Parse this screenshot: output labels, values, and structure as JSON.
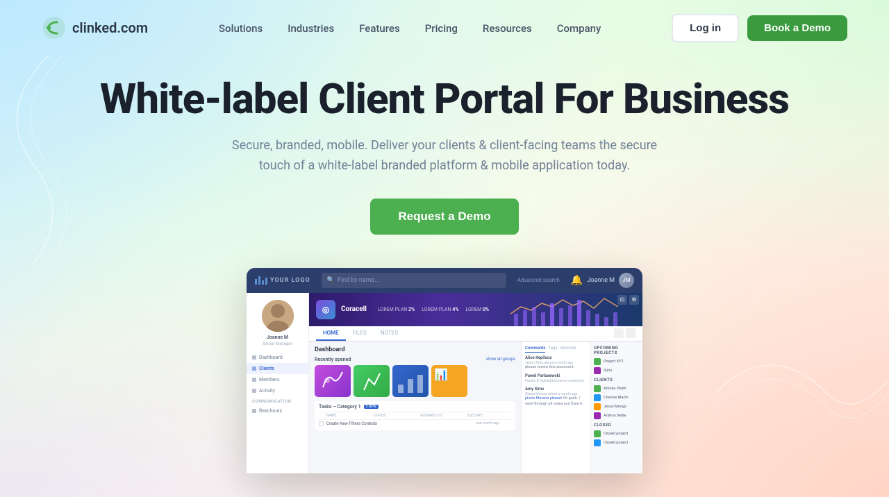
{
  "brand": {
    "name": "clinked.com",
    "logo_icon": "C"
  },
  "nav": {
    "links": [
      {
        "label": "Solutions",
        "id": "solutions"
      },
      {
        "label": "Industries",
        "id": "industries"
      },
      {
        "label": "Features",
        "id": "features"
      },
      {
        "label": "Pricing",
        "id": "pricing"
      },
      {
        "label": "Resources",
        "id": "resources"
      },
      {
        "label": "Company",
        "id": "company"
      }
    ],
    "login_label": "Log in",
    "demo_label": "Book a Demo"
  },
  "hero": {
    "title": "White-label Client Portal For Business",
    "subtitle": "Secure, branded, mobile. Deliver your clients & client-facing teams the secure touch of a white-label branded platform & mobile application today.",
    "cta_label": "Request a Demo"
  },
  "dashboard": {
    "topbar": {
      "logo_text": "YOUR LOGO",
      "search_placeholder": "Find by name...",
      "search_advanced": "Advanced search",
      "user_name": "Joanne M"
    },
    "sidebar": {
      "profile_name": "Joanne M",
      "profile_role": "Senior Manager",
      "items": [
        {
          "label": "Dashboard",
          "active": false
        },
        {
          "label": "Clients",
          "active": true
        },
        {
          "label": "Members",
          "active": false
        },
        {
          "label": "Activity",
          "active": false
        }
      ],
      "sections": [
        {
          "label": "COMMUNICATION",
          "items": [
            "Reachouts"
          ]
        }
      ]
    },
    "client": {
      "name": "Coracell",
      "logo": "◎",
      "stats": [
        {
          "label": "LOREM PLAN",
          "value": "2%"
        },
        {
          "label": "LOREM PLAN",
          "value": "4%"
        },
        {
          "label": "LOREM",
          "value": "0%"
        }
      ],
      "tabs": [
        "HOME",
        "FILES",
        "NOTES"
      ]
    },
    "content": {
      "title": "Dashboard",
      "recently_opened_label": "Recently opened",
      "show_all_label": "show all groups",
      "cards": [
        {
          "color": "purple",
          "label": ""
        },
        {
          "color": "green",
          "label": ""
        },
        {
          "color": "blue",
          "label": ""
        },
        {
          "color": "orange",
          "label": ""
        }
      ],
      "tasks_title": "Tasks – Category 1",
      "tasks_badge": "5 NEW",
      "columns": [
        "NAME",
        "STATUS",
        "ASSIGNED TO",
        "DUE DATE"
      ],
      "task_rows": [
        {
          "name": "Create New Filters Controls",
          "status": "",
          "assigned": "",
          "due": "one month ago"
        }
      ]
    },
    "comments": {
      "tabs": [
        "Comments",
        "Tags",
        "Versions"
      ],
      "items": [
        {
          "user": "Alice Kepilous",
          "time": "Jenny Alma about a month ago",
          "text": "please review this document."
        },
        {
          "user": "Pawel Parlasewski",
          "time": "Frantic D highlighted some connection.",
          "text": ""
        },
        {
          "user": "Amy Sims",
          "time": "Glacia Morana about a month ago",
          "link": "photo Morana please!",
          "text": "Oh gosh. I went through all notes and fixed it."
        }
      ]
    },
    "right_panel": {
      "upcoming_title": "UPCOMING PROJECTS",
      "clients_title": "CLIENTS",
      "projects": [
        {
          "color": "#4CAF50",
          "name": "Project XYZ"
        },
        {
          "color": "#9C27B0",
          "name": "Suris"
        }
      ],
      "clients": [
        {
          "color": "#4CAF50",
          "name": "Amrika Vhahl"
        },
        {
          "color": "#2196F3",
          "name": "Chrome Machi"
        },
        {
          "color": "#FF9800",
          "name": "Jesus Mongo"
        },
        {
          "color": "#9C27B0",
          "name": "Arshoa Sedia"
        }
      ],
      "closed_title": "CLOSED",
      "closed_projects": [
        {
          "color": "#4CAF50",
          "name": "Closed project"
        },
        {
          "color": "#2196F3",
          "name": "Closed project"
        }
      ]
    }
  }
}
